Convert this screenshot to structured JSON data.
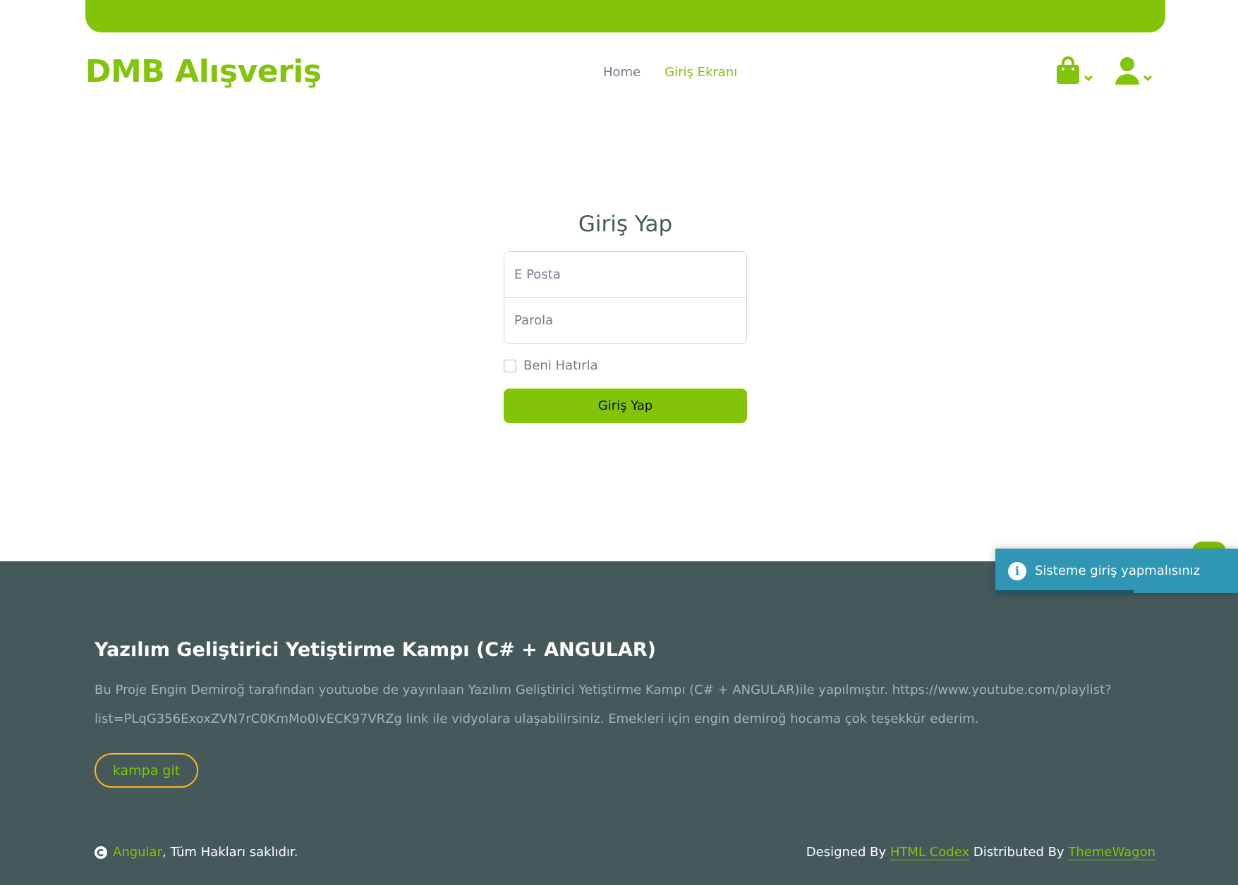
{
  "brand": "DMB Alışveriş",
  "nav": {
    "links": [
      {
        "label": "Home"
      },
      {
        "label": "Giriş Ekranı"
      }
    ],
    "icons": [
      "shopping-bag-icon",
      "user-icon"
    ]
  },
  "login": {
    "title": "Giriş Yap",
    "email_placeholder": "E Posta",
    "password_placeholder": "Parola",
    "remember_label": "Beni Hatırla",
    "submit_label": "Giriş Yap"
  },
  "footer": {
    "title": "Yazılım Geliştirici Yetiştirme Kampı (C# + ANGULAR)",
    "text": "Bu Proje Engin Demiroğ tarafından youtuobe de yayınlaan Yazılım Geliştirici Yetiştirme Kampı (C# + ANGULAR)ile yapılmıştır. https://www.youtube.com/playlist?list=PLqG356ExoxZVN7rC0KmMo0lvECK97VRZg link ile vidyolara ulaşabilirsiniz. Emekleri için engin demiroğ hocama çok teşekkür ederim.",
    "camp_button": "kampa git",
    "copyright_link": "Angular",
    "copyright_rest": ", Tüm Hakları saklıdır.",
    "designed_by": "Designed By ",
    "designer": "HTML Codex",
    "distributed_by": " Distributed By ",
    "distributor": "ThemeWagon"
  },
  "toast": {
    "message": "Sisteme giriş yapmalısınız",
    "icon": "info-icon",
    "progress": 0.57
  },
  "colors": {
    "primary": "#81c408",
    "footer_bg": "#45595b",
    "accent_border": "#ffb524",
    "toast_bg": "#2f96b4"
  }
}
